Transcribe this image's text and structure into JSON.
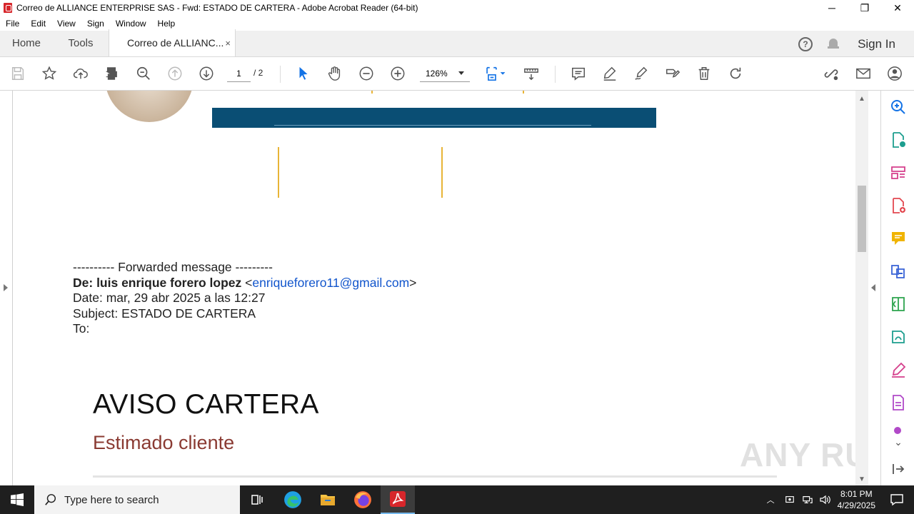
{
  "window": {
    "title": "Correo de ALLIANCE ENTERPRISE SAS - Fwd: ESTADO DE CARTERA - Adobe Acrobat Reader (64-bit)",
    "minimize": "─",
    "maximize": "❐",
    "close": "✕"
  },
  "menu": [
    "File",
    "Edit",
    "View",
    "Sign",
    "Window",
    "Help"
  ],
  "tabs": {
    "home": "Home",
    "tools": "Tools",
    "document": "Correo de ALLIANC...",
    "close": "×",
    "help": "?",
    "sign_in": "Sign In"
  },
  "toolbar": {
    "page_current": "1",
    "page_total": "/ 2",
    "zoom": "126%"
  },
  "email": {
    "forwarded_line": "---------- Forwarded message ---------",
    "from_label": "De: ",
    "from_name": "luis enrique forero lopez",
    "from_email_open": " <",
    "from_email": "enriqueforero11@gmail.com",
    "from_email_close": ">",
    "date": "Date: mar, 29 abr 2025 a las 12:27",
    "subject": "Subject: ESTADO DE CARTERA",
    "to": "To:"
  },
  "document": {
    "heading": "AVISO CARTERA",
    "subheading": "Estimado cliente",
    "watermark": "ANY RUN"
  },
  "taskbar": {
    "search_placeholder": "Type here to search",
    "time": "8:01 PM",
    "date": "4/29/2025"
  },
  "colors": {
    "banner": "#0a4e74",
    "gold": "#e8b437",
    "link": "#1155cc",
    "subheading": "#8a3a32",
    "acrobat_red": "#d7262b"
  }
}
